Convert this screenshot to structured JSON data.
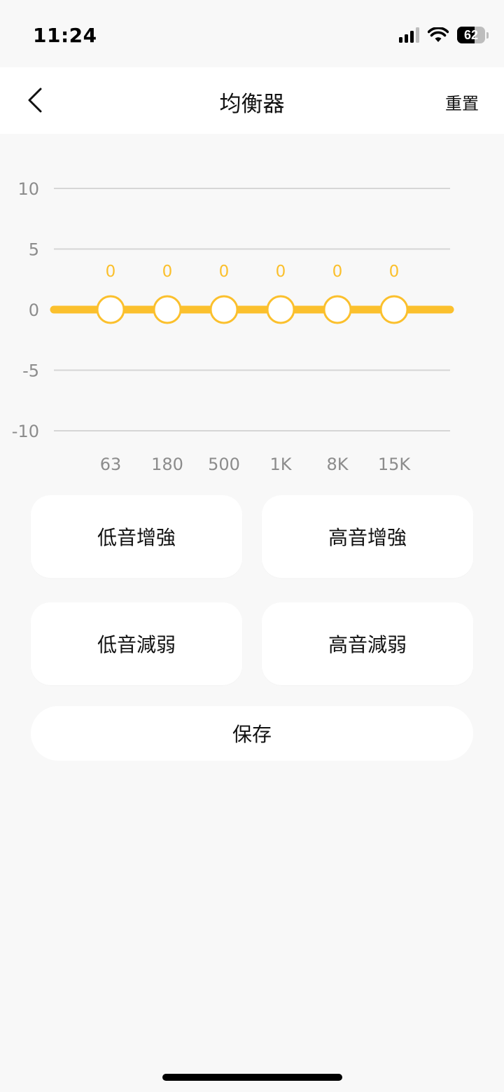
{
  "status_bar": {
    "time": "11:24",
    "battery_level": "62",
    "battery_fraction": 0.62,
    "icons": [
      "signal-icon",
      "wifi-icon",
      "battery-icon"
    ]
  },
  "header": {
    "title": "均衡器",
    "reset_label": "重置",
    "back_icon": "chevron-left-icon"
  },
  "chart_data": {
    "type": "line",
    "y_ticks": [
      "10",
      "5",
      "0",
      "-5",
      "-10"
    ],
    "ylim": [
      -10,
      10
    ],
    "bands": [
      "63",
      "180",
      "500",
      "1K",
      "8K",
      "15K"
    ],
    "values": [
      0,
      0,
      0,
      0,
      0,
      0
    ],
    "value_labels": [
      "0",
      "0",
      "0",
      "0",
      "0",
      "0"
    ],
    "grid": true,
    "accent_color": "#fbc02d",
    "grid_color": "#d6d6d6",
    "label_color": "#8c8c8c"
  },
  "presets": [
    {
      "label": "低音增強"
    },
    {
      "label": "高音增強"
    },
    {
      "label": "低音減弱"
    },
    {
      "label": "高音減弱"
    }
  ],
  "save_label": "保存"
}
